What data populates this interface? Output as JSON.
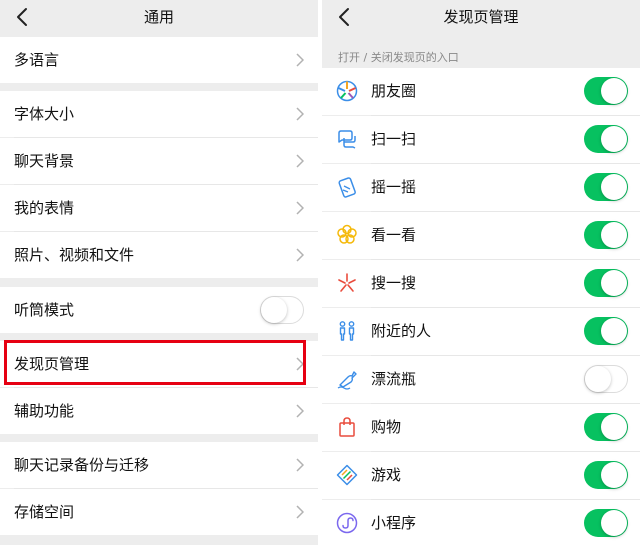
{
  "left": {
    "title": "通用",
    "items": [
      {
        "label": "多语言"
      },
      {
        "label": "字体大小"
      },
      {
        "label": "聊天背景"
      },
      {
        "label": "我的表情"
      },
      {
        "label": "照片、视频和文件"
      },
      {
        "label": "听筒模式",
        "toggle": "off"
      },
      {
        "label": "发现页管理",
        "highlighted": true
      },
      {
        "label": "辅助功能"
      },
      {
        "label": "聊天记录备份与迁移"
      },
      {
        "label": "存储空间"
      }
    ]
  },
  "right": {
    "title": "发现页管理",
    "section_label": "打开 / 关闭发现页的入口",
    "items": [
      {
        "label": "朋友圈",
        "icon": "moments-icon",
        "toggle": "on"
      },
      {
        "label": "扫一扫",
        "icon": "scan-icon",
        "toggle": "on"
      },
      {
        "label": "摇一摇",
        "icon": "shake-icon",
        "toggle": "on"
      },
      {
        "label": "看一看",
        "icon": "top-stories-icon",
        "toggle": "on"
      },
      {
        "label": "搜一搜",
        "icon": "search-icon",
        "toggle": "on"
      },
      {
        "label": "附近的人",
        "icon": "people-nearby-icon",
        "toggle": "on"
      },
      {
        "label": "漂流瓶",
        "icon": "drift-bottle-icon",
        "toggle": "off"
      },
      {
        "label": "购物",
        "icon": "shopping-icon",
        "toggle": "on"
      },
      {
        "label": "游戏",
        "icon": "games-icon",
        "toggle": "on"
      },
      {
        "label": "小程序",
        "icon": "mini-programs-icon",
        "toggle": "on"
      }
    ]
  },
  "colors": {
    "accent_green": "#07c160",
    "highlight_red": "#e60012",
    "background_gray": "#ededed"
  }
}
